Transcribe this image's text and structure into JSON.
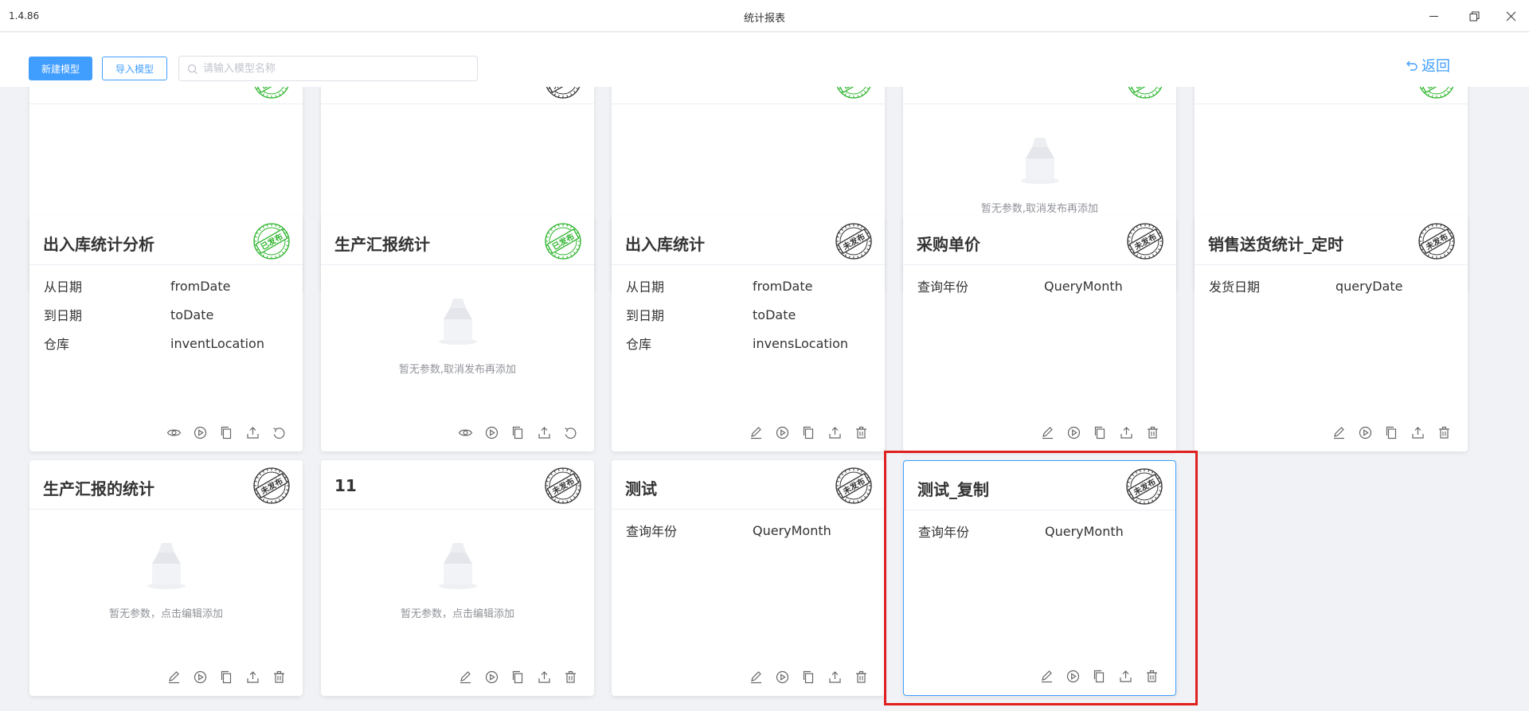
{
  "window": {
    "version": "1.4.86",
    "title": "统计报表"
  },
  "toolbar": {
    "new_label": "新建模型",
    "import_label": "导入模型",
    "search_placeholder": "请输入模型名称",
    "back_label": "返回"
  },
  "rows": [
    {
      "cards": [
        {
          "title": "",
          "status": "已发布",
          "params": [],
          "empty_text": "",
          "actions": [
            "view",
            "run",
            "copy",
            "export",
            "unpublish"
          ]
        },
        {
          "title": "",
          "status": "未发布",
          "params": [],
          "empty_text": "",
          "actions": [
            "edit",
            "run",
            "copy",
            "export",
            "delete"
          ]
        },
        {
          "title": "",
          "status": "已发布",
          "params": [],
          "empty_text": "",
          "actions": [
            "view",
            "run",
            "copy",
            "export",
            "unpublish"
          ]
        },
        {
          "title": "",
          "status": "已发布",
          "params": [],
          "empty_text": "暂无参数,取消发布再添加",
          "actions": [
            "view",
            "run",
            "copy",
            "export",
            "unpublish"
          ]
        },
        {
          "title": "",
          "status": "已发布",
          "params": [],
          "empty_text": "",
          "actions": [
            "view",
            "run",
            "copy",
            "export",
            "unpublish"
          ]
        }
      ]
    },
    {
      "cards": [
        {
          "title": "出入库统计分析",
          "status": "已发布",
          "params": [
            [
              "从日期",
              "fromDate"
            ],
            [
              "到日期",
              "toDate"
            ],
            [
              "仓库",
              "inventLocation"
            ]
          ],
          "empty_text": "",
          "actions": [
            "view",
            "run",
            "copy",
            "export",
            "unpublish"
          ]
        },
        {
          "title": "生产汇报统计",
          "status": "已发布",
          "params": [],
          "empty_text": "暂无参数,取消发布再添加",
          "actions": [
            "view",
            "run",
            "copy",
            "export",
            "unpublish"
          ]
        },
        {
          "title": "出入库统计",
          "status": "未发布",
          "params": [
            [
              "从日期",
              "fromDate"
            ],
            [
              "到日期",
              "toDate"
            ],
            [
              "仓库",
              "invensLocation"
            ]
          ],
          "empty_text": "",
          "actions": [
            "edit",
            "run",
            "copy",
            "export",
            "delete"
          ]
        },
        {
          "title": "采购单价",
          "status": "未发布",
          "params": [
            [
              "查询年份",
              "QueryMonth"
            ]
          ],
          "empty_text": "",
          "actions": [
            "edit",
            "run",
            "copy",
            "export",
            "delete"
          ]
        },
        {
          "title": "销售送货统计_定时",
          "status": "未发布",
          "params": [
            [
              "发货日期",
              "queryDate"
            ]
          ],
          "empty_text": "",
          "actions": [
            "edit",
            "run",
            "copy",
            "export",
            "delete"
          ]
        }
      ]
    },
    {
      "cards": [
        {
          "title": "生产汇报的统计",
          "status": "未发布",
          "params": [],
          "empty_text": "暂无参数，点击编辑添加",
          "actions": [
            "edit",
            "run",
            "copy",
            "export",
            "delete"
          ]
        },
        {
          "title": "11",
          "status": "未发布",
          "params": [],
          "empty_text": "暂无参数，点击编辑添加",
          "actions": [
            "edit",
            "run",
            "copy",
            "export",
            "delete"
          ]
        },
        {
          "title": "测试",
          "status": "未发布",
          "params": [
            [
              "查询年份",
              "QueryMonth"
            ]
          ],
          "empty_text": "",
          "actions": [
            "edit",
            "run",
            "copy",
            "export",
            "delete"
          ]
        },
        {
          "title": "测试_复制",
          "status": "未发布",
          "params": [
            [
              "查询年份",
              "QueryMonth"
            ]
          ],
          "empty_text": "",
          "actions": [
            "edit",
            "run",
            "copy",
            "export",
            "delete"
          ],
          "selected": true
        }
      ]
    }
  ],
  "colors": {
    "accent": "#409eff",
    "published": "#2db52d",
    "unpublished": "#333333",
    "highlight": "#e02020"
  }
}
